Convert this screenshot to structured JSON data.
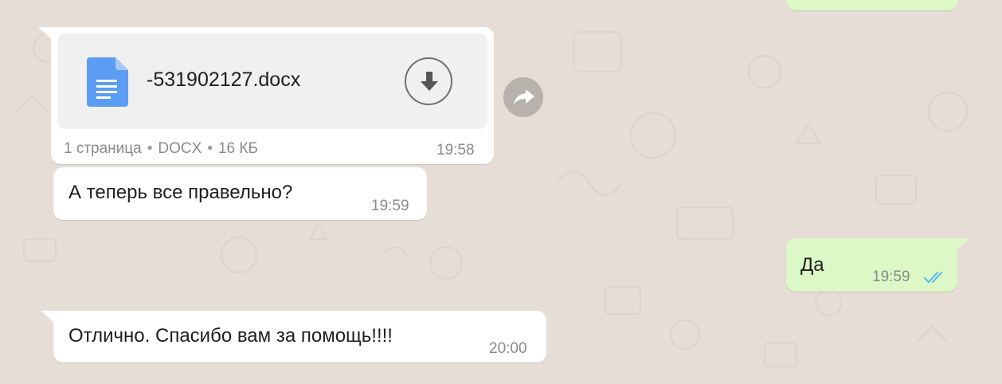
{
  "messages": {
    "document": {
      "file_name": "-531902127.docx",
      "pages": "1 страница",
      "type": "DOCX",
      "size": "16 КБ",
      "time": "19:58",
      "icon": "document-icon",
      "download_icon": "download-icon",
      "forward_icon": "forward-icon"
    },
    "incoming_1": {
      "text": "А теперь все правельно?",
      "time": "19:59"
    },
    "outgoing_1": {
      "text": "Да",
      "time": "19:59",
      "status_icon": "double-check-icon",
      "status_color": "#53bdeb"
    },
    "incoming_2": {
      "text": "Отлично. Спасибо вам за помощь!!!!",
      "time": "20:00"
    }
  },
  "colors": {
    "chat_background": "#e6ded6",
    "incoming_bubble": "#ffffff",
    "outgoing_bubble": "#dcf8c6",
    "doc_icon": "#5b9cf4"
  }
}
